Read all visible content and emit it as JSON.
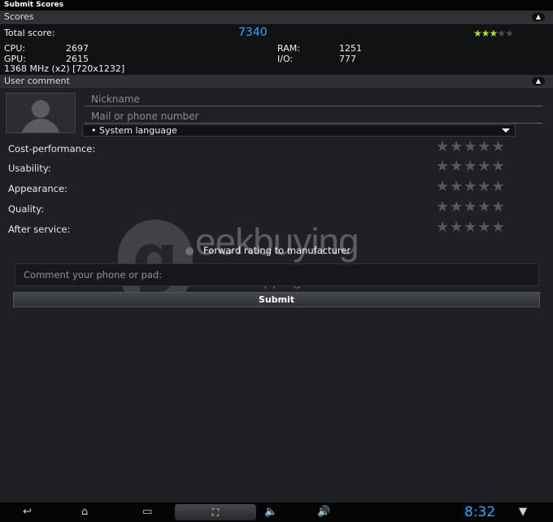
{
  "window": {
    "title": "Submit Scores"
  },
  "scores": {
    "header": "Scores",
    "total_label": "Total score:",
    "total_value": "7340",
    "stars_full": "★★",
    "stars_half": "★",
    "stars_empty": "★★",
    "cpu_label": "CPU:",
    "cpu_value": "2697",
    "gpu_label": "GPU:",
    "gpu_value": "2615",
    "ram_label": "RAM:",
    "ram_value": "1251",
    "io_label": "I/O:",
    "io_value": "777",
    "device_info": "1368 MHz (x2) [720x1232]"
  },
  "comment": {
    "header": "User comment",
    "nickname_placeholder": "Nickname",
    "mail_placeholder": "Mail or phone number",
    "language_value": "• System language",
    "ratings": [
      {
        "label": "Cost-performance:",
        "stars": "★★★★★"
      },
      {
        "label": "Usability:",
        "stars": "★★★★★"
      },
      {
        "label": "Appearance:",
        "stars": "★★★★★"
      },
      {
        "label": "Quality:",
        "stars": "★★★★★"
      },
      {
        "label": "After service:",
        "stars": "★★★★★"
      }
    ],
    "forward_label": "Forward rating to manufacturer",
    "comment_placeholder": "Comment your phone or pad:",
    "submit_label": "Submit"
  },
  "watermark": {
    "logo_letter": "g",
    "brand": "eekbuying",
    "tagline": "Freeshipping worldwide"
  },
  "navbar": {
    "back_icon": "↩",
    "home_icon": "⌂",
    "recents_icon": "▭",
    "screenshot_icon": "⛶",
    "vol_down_icon": "🔈",
    "vol_up_icon": "🔊",
    "clock": "8:32",
    "wifi_icon": "▼"
  },
  "colors": {
    "accent": "#3aa5ff",
    "star_active": "#a6e22e",
    "background": "#1f2024"
  }
}
